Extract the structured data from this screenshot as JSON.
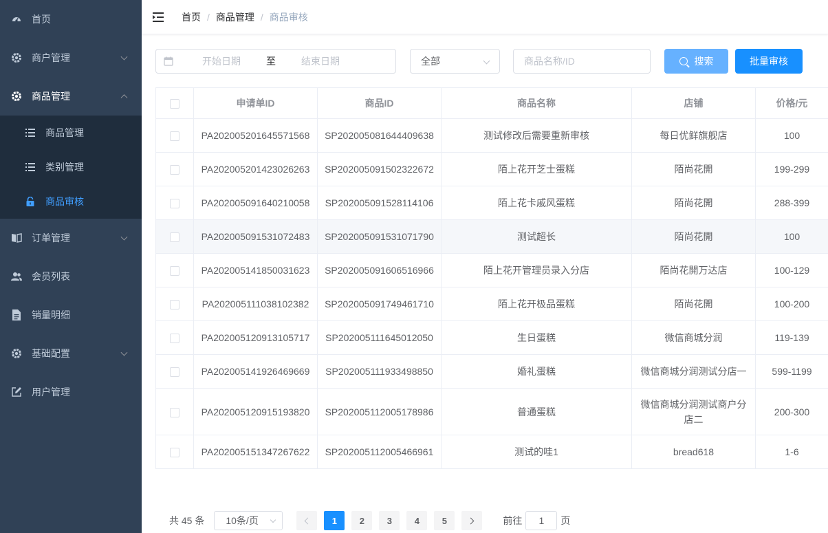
{
  "sidebar": {
    "items": [
      {
        "label": "首页",
        "icon": "dashboard-icon"
      },
      {
        "label": "商户管理",
        "icon": "gear-icon",
        "expandable": true
      },
      {
        "label": "商品管理",
        "icon": "gear-icon",
        "expandable": true,
        "expanded": true,
        "children": [
          {
            "label": "商品管理",
            "icon": "list-icon"
          },
          {
            "label": "类别管理",
            "icon": "list-icon"
          },
          {
            "label": "商品审核",
            "icon": "lock-icon",
            "active": true
          }
        ]
      },
      {
        "label": "订单管理",
        "icon": "book-icon",
        "expandable": true
      },
      {
        "label": "会员列表",
        "icon": "users-icon"
      },
      {
        "label": "销量明细",
        "icon": "document-icon"
      },
      {
        "label": "基础配置",
        "icon": "gear-icon",
        "expandable": true
      },
      {
        "label": "用户管理",
        "icon": "edit-icon"
      }
    ]
  },
  "navbar": {
    "breadcrumb": [
      "首页",
      "商品管理",
      "商品审核"
    ],
    "separator": "/"
  },
  "filters": {
    "start_placeholder": "开始日期",
    "range_separator": "至",
    "end_placeholder": "结束日期",
    "status_value": "全部",
    "keyword_placeholder": "商品名称/ID",
    "search_label": "搜索",
    "batch_label": "批量审核"
  },
  "table": {
    "columns": [
      "申请单ID",
      "商品ID",
      "商品名称",
      "店铺",
      "价格/元"
    ],
    "rows": [
      [
        "PA202005201645571568",
        "SP202005081644409638",
        "测试修改后需要重新审核",
        "每日优鲜旗舰店",
        "100"
      ],
      [
        "PA202005201423026263",
        "SP202005091502322672",
        "陌上花开芝士蛋糕",
        "陌尚花開",
        "199-299"
      ],
      [
        "PA202005091640210058",
        "SP202005091528114106",
        "陌上花卡戚风蛋糕",
        "陌尚花開",
        "288-399"
      ],
      [
        "PA202005091531072483",
        "SP202005091531071790",
        "测试超长",
        "陌尚花開",
        "100"
      ],
      [
        "PA202005141850031623",
        "SP202005091606516966",
        "陌上花开管理员录入分店",
        "陌尚花開万达店",
        "100-129"
      ],
      [
        "PA202005111038102382",
        "SP202005091749461710",
        "陌上花开极品蛋糕",
        "陌尚花開",
        "100-200"
      ],
      [
        "PA202005120913105717",
        "SP202005111645012050",
        "生日蛋糕",
        "微信商城分润",
        "119-139"
      ],
      [
        "PA202005141926469669",
        "SP202005111933498850",
        "婚礼蛋糕",
        "微信商城分润测试分店一",
        "599-1199"
      ],
      [
        "PA202005120915193820",
        "SP202005112005178986",
        "普通蛋糕",
        "微信商城分润测试商户分店二",
        "200-300"
      ],
      [
        "PA202005151347267622",
        "SP202005112005466961",
        "测试的哇1",
        "bread618",
        "1-6"
      ]
    ]
  },
  "pagination": {
    "total_text": "共 45 条",
    "page_size": "10条/页",
    "pages": [
      "1",
      "2",
      "3",
      "4",
      "5"
    ],
    "current": "1",
    "goto_prefix": "前往",
    "goto_value": "1",
    "goto_suffix": "页"
  },
  "colors": {
    "sidebar_bg": "#304156",
    "submenu_bg": "#1f2d3d",
    "accent": "#1890ff",
    "search_button": "#66b1ff"
  }
}
